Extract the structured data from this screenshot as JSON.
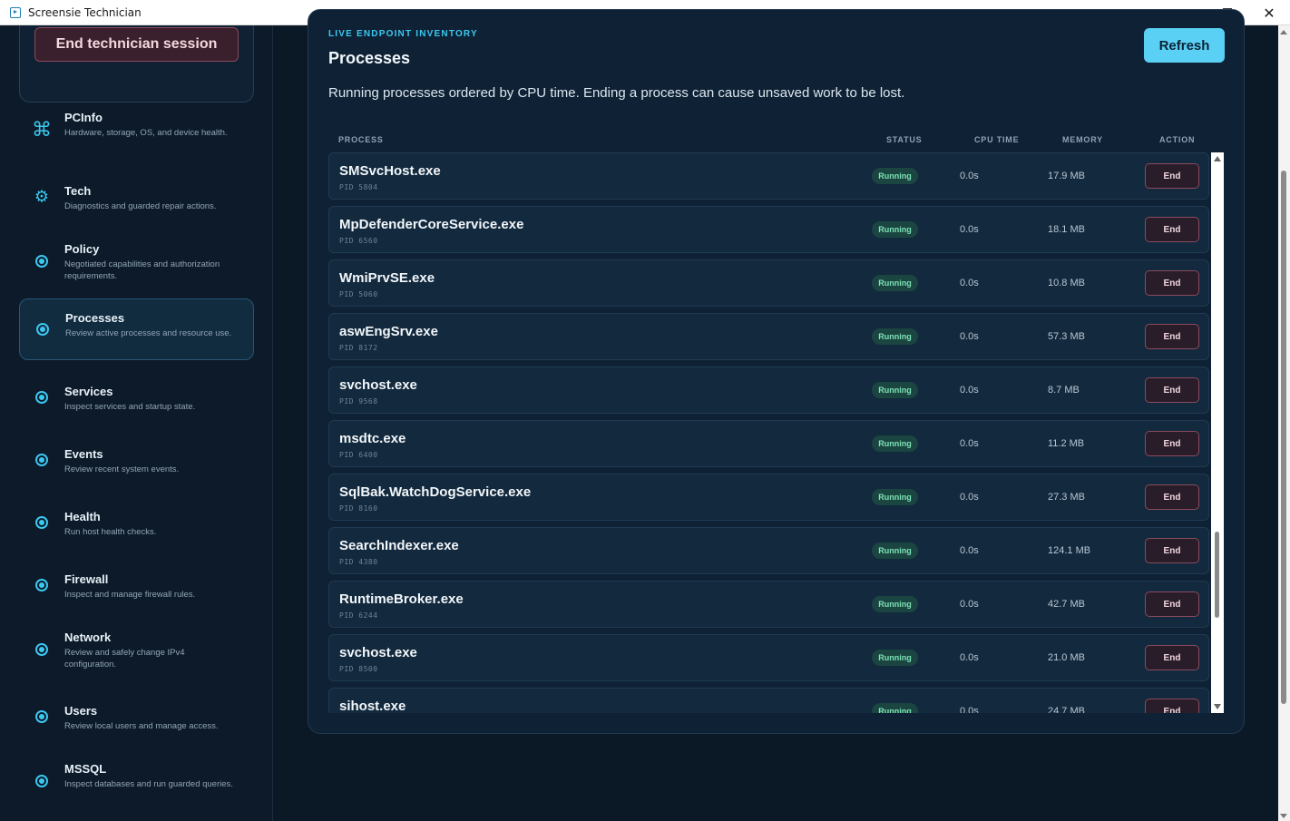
{
  "window": {
    "title": "Screensie Technician"
  },
  "session": {
    "end_label": "End technician session"
  },
  "sidebar": {
    "items": [
      {
        "title": "PCInfo",
        "desc": "Hardware, storage, OS, and device health.",
        "icon": "command-icon"
      },
      {
        "title": "Tech",
        "desc": "Diagnostics and guarded repair actions.",
        "icon": "gear-icon"
      },
      {
        "title": "Policy",
        "desc": "Negotiated capabilities and authorization requirements.",
        "icon": "dot-icon"
      },
      {
        "title": "Processes",
        "desc": "Review active processes and resource use.",
        "icon": "dot-icon"
      },
      {
        "title": "Services",
        "desc": "Inspect services and startup state.",
        "icon": "dot-icon"
      },
      {
        "title": "Events",
        "desc": "Review recent system events.",
        "icon": "dot-icon"
      },
      {
        "title": "Health",
        "desc": "Run host health checks.",
        "icon": "dot-icon"
      },
      {
        "title": "Firewall",
        "desc": "Inspect and manage firewall rules.",
        "icon": "dot-icon"
      },
      {
        "title": "Network",
        "desc": "Review and safely change IPv4 configuration.",
        "icon": "dot-icon"
      },
      {
        "title": "Users",
        "desc": "Review local users and manage access.",
        "icon": "dot-icon"
      },
      {
        "title": "MSSQL",
        "desc": "Inspect databases and run guarded queries.",
        "icon": "dot-icon"
      }
    ],
    "active": "Processes"
  },
  "main": {
    "eyebrow": "LIVE ENDPOINT INVENTORY",
    "title": "Processes",
    "refresh_label": "Refresh",
    "subtitle": "Running processes ordered by CPU time. Ending a process can cause unsaved work to be lost.",
    "columns": {
      "process": "PROCESS",
      "status": "STATUS",
      "cpu": "CPU TIME",
      "memory": "MEMORY",
      "action": "ACTION"
    },
    "end_label": "End",
    "rows": [
      {
        "name": "SMSvcHost.exe",
        "pid": "PID 5804",
        "status": "Running",
        "cpu": "0.0s",
        "memory": "17.9 MB"
      },
      {
        "name": "MpDefenderCoreService.exe",
        "pid": "PID 6560",
        "status": "Running",
        "cpu": "0.0s",
        "memory": "18.1 MB"
      },
      {
        "name": "WmiPrvSE.exe",
        "pid": "PID 5060",
        "status": "Running",
        "cpu": "0.0s",
        "memory": "10.8 MB"
      },
      {
        "name": "aswEngSrv.exe",
        "pid": "PID 8172",
        "status": "Running",
        "cpu": "0.0s",
        "memory": "57.3 MB"
      },
      {
        "name": "svchost.exe",
        "pid": "PID 9568",
        "status": "Running",
        "cpu": "0.0s",
        "memory": "8.7 MB"
      },
      {
        "name": "msdtc.exe",
        "pid": "PID 6400",
        "status": "Running",
        "cpu": "0.0s",
        "memory": "11.2 MB"
      },
      {
        "name": "SqlBak.WatchDogService.exe",
        "pid": "PID 8160",
        "status": "Running",
        "cpu": "0.0s",
        "memory": "27.3 MB"
      },
      {
        "name": "SearchIndexer.exe",
        "pid": "PID 4380",
        "status": "Running",
        "cpu": "0.0s",
        "memory": "124.1 MB"
      },
      {
        "name": "RuntimeBroker.exe",
        "pid": "PID 6244",
        "status": "Running",
        "cpu": "0.0s",
        "memory": "42.7 MB"
      },
      {
        "name": "svchost.exe",
        "pid": "PID 8500",
        "status": "Running",
        "cpu": "0.0s",
        "memory": "21.0 MB"
      },
      {
        "name": "sihost.exe",
        "pid": "",
        "status": "Running",
        "cpu": "0.0s",
        "memory": "24.7 MB"
      }
    ]
  },
  "colors": {
    "accent": "#3cc8f0",
    "danger_border": "#8a4a5e",
    "running": "#7fe3b6"
  }
}
